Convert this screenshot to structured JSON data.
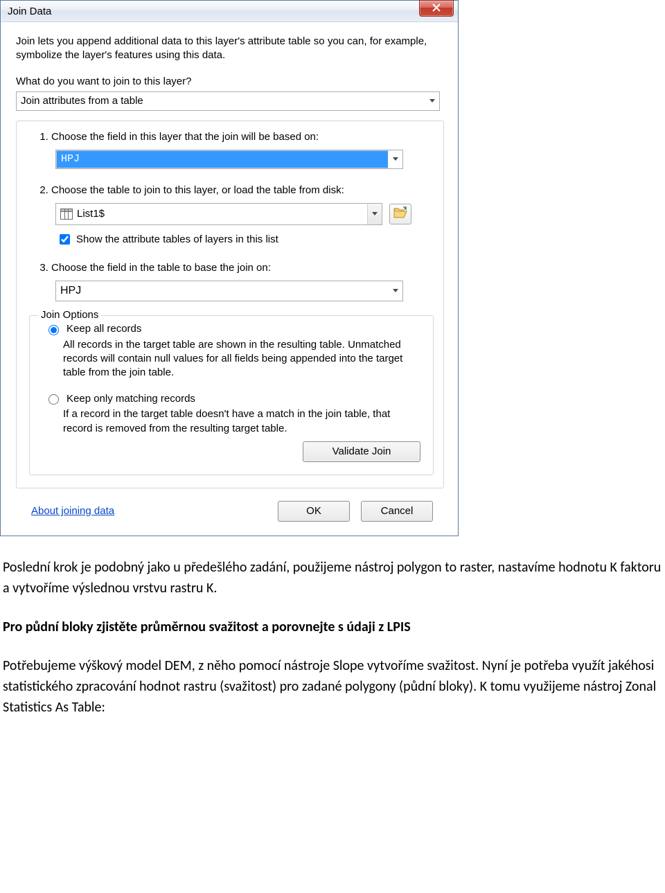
{
  "dialog": {
    "title": "Join Data",
    "intro": "Join lets you append additional data to this layer's attribute table so you can, for example, symbolize the layer's features using this data.",
    "question": "What do you want to join to this layer?",
    "join_type_value": "Join attributes from a table",
    "step1": {
      "label": "Choose the field in this layer that the join will be based on:",
      "value": "HPJ"
    },
    "step2": {
      "label": "Choose the table to join to this layer, or load the table from disk:",
      "value": "List1$",
      "checkbox_label": "Show the attribute tables of layers in this list",
      "checkbox_checked": true
    },
    "step3": {
      "label": "Choose the field in the table to base the join on:",
      "value": "HPJ"
    },
    "options": {
      "legend": "Join Options",
      "keep_all": {
        "label": "Keep all records",
        "desc": "All records in the target table are shown in the resulting table. Unmatched records will contain null values for all fields being appended into the target table from the join table."
      },
      "keep_match": {
        "label": "Keep only matching records",
        "desc": "If a record in the target table doesn't have a match in the join table, that record is removed from the resulting target table."
      },
      "selected": "keep_all"
    },
    "validate_btn": "Validate Join",
    "about_link": "About joining data",
    "ok_btn": "OK",
    "cancel_btn": "Cancel"
  },
  "doc": {
    "p1": "Poslední krok je podobný jako u předešlého zadání, použijeme nástroj polygon to raster, nastavíme hodnotu K faktoru a vytvoříme výslednou vrstvu rastru K.",
    "p2_bold": "Pro půdní bloky zjistěte průměrnou svažitost a porovnejte s údaji z LPIS",
    "p3": "Potřebujeme výškový model DEM, z něho pomocí nástroje Slope vytvoříme svažitost. Nyní je potřeba využít jakéhosi statistického zpracování hodnot rastru (svažitost) pro zadané polygony (půdní bloky). K tomu využijeme nástroj Zonal Statistics As Table:"
  }
}
